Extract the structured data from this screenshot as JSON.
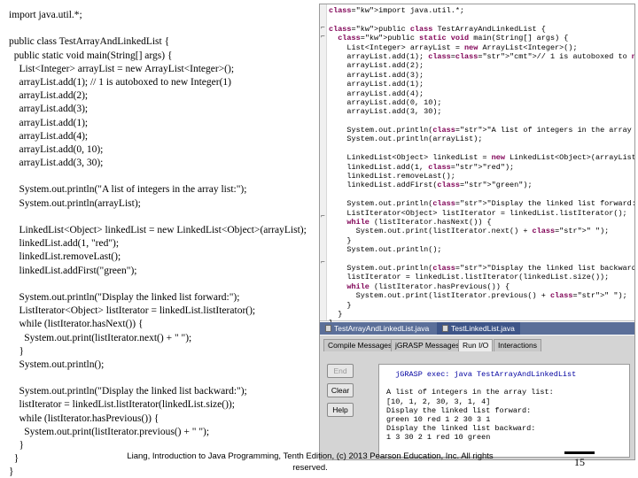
{
  "slide": {
    "code_lines": [
      "import java.util.*;",
      "",
      "public class TestArrayAndLinkedList {",
      "  public static void main(String[] args) {",
      "    List<Integer> arrayList = new ArrayList<Integer>();",
      "    arrayList.add(1); // 1 is autoboxed to new Integer(1)",
      "    arrayList.add(2);",
      "    arrayList.add(3);",
      "    arrayList.add(1);",
      "    arrayList.add(4);",
      "    arrayList.add(0, 10);",
      "    arrayList.add(3, 30);",
      "",
      "    System.out.println(\"A list of integers in the array list:\");",
      "    System.out.println(arrayList);",
      "",
      "    LinkedList<Object> linkedList = new LinkedList<Object>(arrayList);",
      "    linkedList.add(1, \"red\");",
      "    linkedList.removeLast();",
      "    linkedList.addFirst(\"green\");",
      "",
      "    System.out.println(\"Display the linked list forward:\");",
      "    ListIterator<Object> listIterator = linkedList.listIterator();",
      "    while (listIterator.hasNext()) {",
      "      System.out.print(listIterator.next() + \" \");",
      "    }",
      "    System.out.println();",
      "",
      "    System.out.println(\"Display the linked list backward:\");",
      "    listIterator = linkedList.listIterator(linkedList.size());",
      "    while (listIterator.hasPrevious()) {",
      "      System.out.print(listIterator.previous() + \" \");",
      "    }",
      "  }",
      "}"
    ],
    "footer": "Liang, Introduction to Java Programming, Tenth Edition, (c) 2013 Pearson Education, Inc. All rights reserved.",
    "page_number": "15"
  },
  "ide": {
    "editor_lines": [
      "import java.util.*;",
      "",
      "public class TestArrayAndLinkedList {",
      "  public static void main(String[] args) {",
      "    List<Integer> arrayList = new ArrayList<Integer>();",
      "    arrayList.add(1); // 1 is autoboxed to new Integer(1)",
      "    arrayList.add(2);",
      "    arrayList.add(3);",
      "    arrayList.add(1);",
      "    arrayList.add(4);",
      "    arrayList.add(0, 10);",
      "    arrayList.add(3, 30);",
      "",
      "    System.out.println(\"A list of integers in the array list:\");",
      "    System.out.println(arrayList);",
      "",
      "    LinkedList<Object> linkedList = new LinkedList<Object>(arrayList);",
      "    linkedList.add(1, \"red\");",
      "    linkedList.removeLast();",
      "    linkedList.addFirst(\"green\");",
      "",
      "    System.out.println(\"Display the linked list forward:\");",
      "    ListIterator<Object> listIterator = linkedList.listIterator();",
      "    while (listIterator.hasNext()) {",
      "      System.out.print(listIterator.next() + \" \");",
      "    }",
      "    System.out.println();",
      "",
      "    System.out.println(\"Display the linked list backward:\");",
      "    listIterator = linkedList.listIterator(linkedList.size());",
      "    while (listIterator.hasPrevious()) {",
      "      System.out.print(listIterator.previous() + \" \");",
      "    }",
      "  }",
      "}"
    ],
    "tabs": [
      {
        "label": "TestArrayAndLinkedList.java",
        "active": false
      },
      {
        "label": "TestLinkedList.java",
        "active": true
      }
    ],
    "panel_tabs": [
      {
        "label": "Compile Messages",
        "active": false
      },
      {
        "label": "jGRASP Messages",
        "active": false
      },
      {
        "label": "Run I/O",
        "active": true
      },
      {
        "label": "Interactions",
        "active": false
      }
    ],
    "buttons": {
      "end": "End",
      "clear": "Clear",
      "help": "Help"
    },
    "output_lines": [
      "  jGRASP exec: java TestArrayAndLinkedList",
      "",
      "A list of integers in the array list:",
      "[10, 1, 2, 30, 3, 1, 4]",
      "Display the linked list forward:",
      "green 10 red 1 2 30 3 1",
      "Display the linked list backward:",
      "1 3 30 2 1 red 10 green"
    ]
  }
}
